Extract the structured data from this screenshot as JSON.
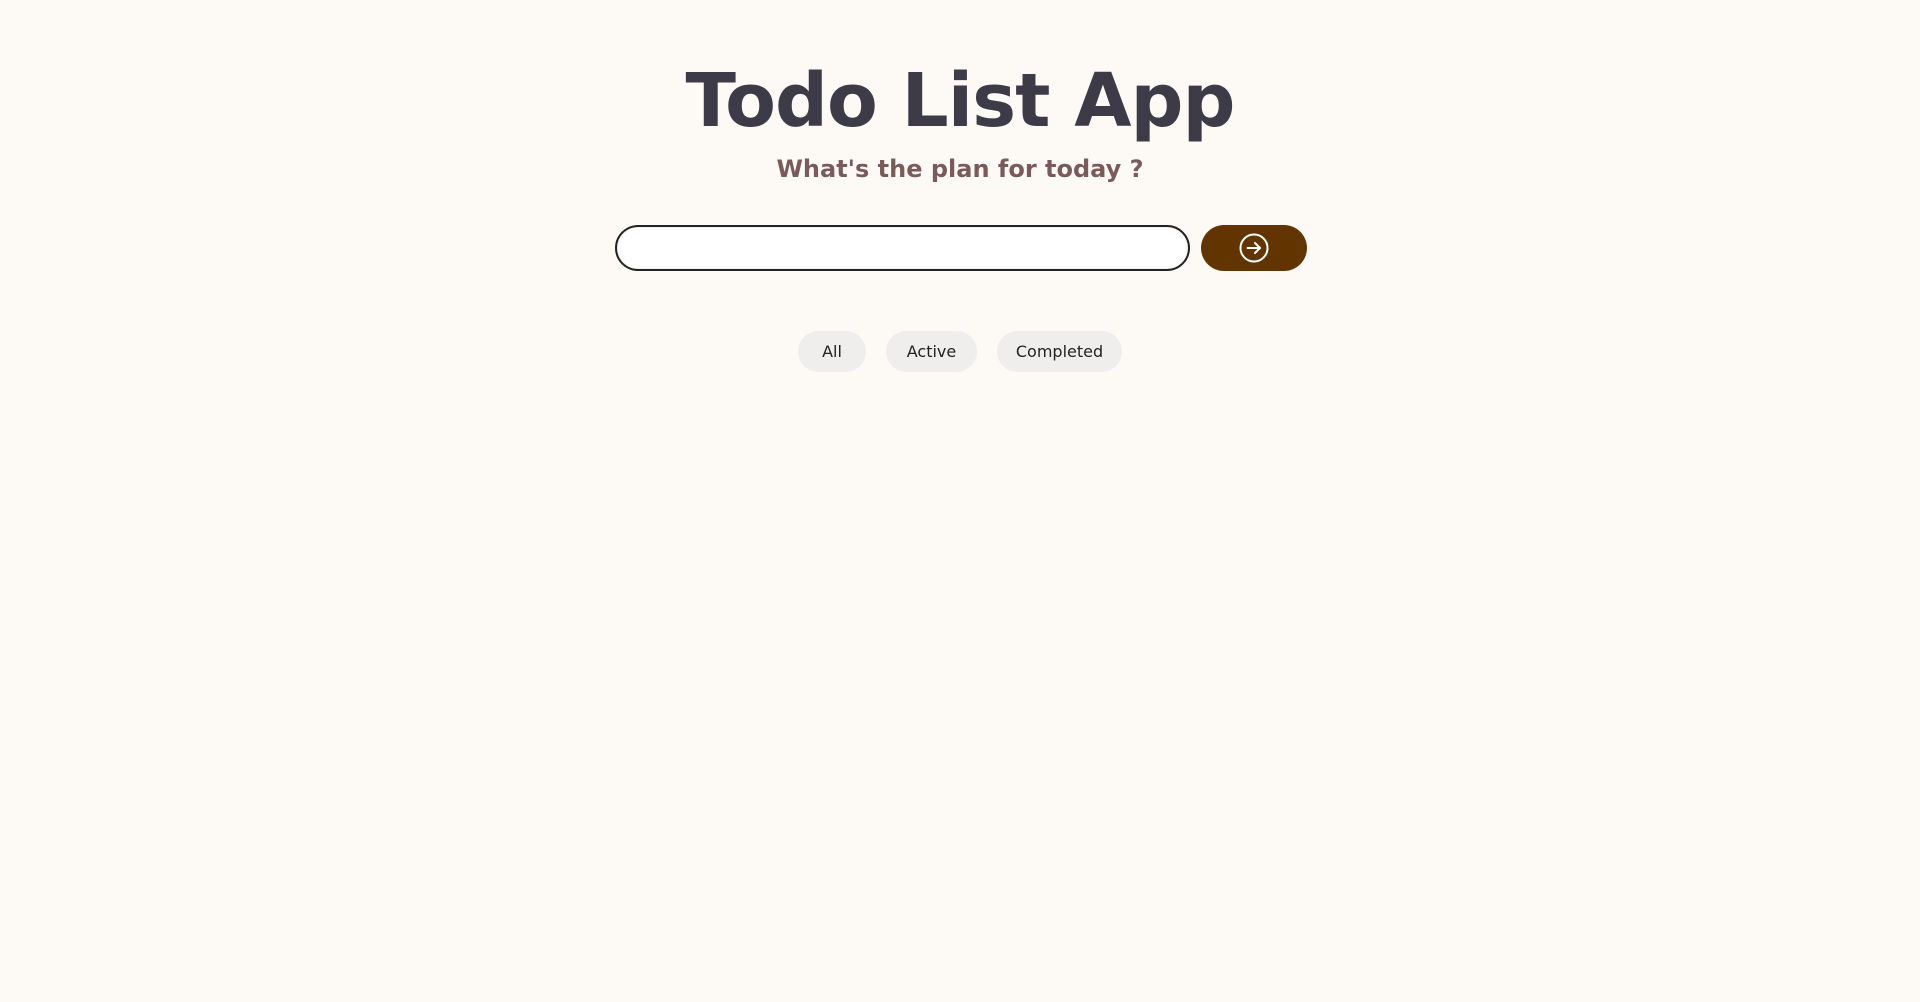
{
  "header": {
    "title": "Todo List App",
    "subtitle": "What's the plan for today ?"
  },
  "form": {
    "input_value": "",
    "input_placeholder": "",
    "submit_icon": "arrow-right-circle-icon"
  },
  "filters": {
    "items": [
      {
        "label": "All"
      },
      {
        "label": "Active"
      },
      {
        "label": "Completed"
      }
    ]
  },
  "colors": {
    "background": "#fdfaf6",
    "title": "#3d3b47",
    "subtitle": "#7a5a5a",
    "accent": "#623500",
    "filter_bg": "#efeeed"
  }
}
